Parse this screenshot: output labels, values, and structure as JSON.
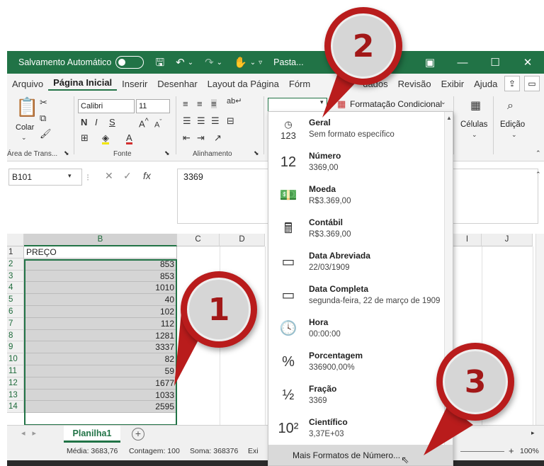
{
  "titlebar": {
    "autosave_label": "Salvamento Automático",
    "toggle_state": "Desativado",
    "filename": "Pasta..."
  },
  "menu": [
    "Arquivo",
    "Página Inicial",
    "Inserir",
    "Desenhar",
    "Layout da Página",
    "Fórm",
    "dados",
    "Revisão",
    "Exibir",
    "Ajuda"
  ],
  "ribbon": {
    "paste_label": "Colar",
    "clipboard_group": "Área de Trans...",
    "font_name": "Calibri",
    "font_size": "11",
    "font_group": "Fonte",
    "align_group": "Alinhamento",
    "number_format_value": "",
    "conditional_format": "Formatação Condicional",
    "cells_label": "Células",
    "edit_label": "Edição"
  },
  "formula_bar": {
    "cell_ref": "B101",
    "formula": "3369"
  },
  "grid": {
    "columns": [
      "B",
      "C",
      "D",
      "I",
      "J"
    ],
    "rows": [
      {
        "row": "1",
        "value": "PREÇO"
      },
      {
        "row": "2",
        "value": "853"
      },
      {
        "row": "3",
        "value": "853"
      },
      {
        "row": "4",
        "value": "1010"
      },
      {
        "row": "5",
        "value": "40"
      },
      {
        "row": "6",
        "value": "102"
      },
      {
        "row": "7",
        "value": "112"
      },
      {
        "row": "8",
        "value": "1281"
      },
      {
        "row": "9",
        "value": "3337"
      },
      {
        "row": "10",
        "value": "82"
      },
      {
        "row": "11",
        "value": "59"
      },
      {
        "row": "12",
        "value": "1677"
      },
      {
        "row": "13",
        "value": "1033"
      },
      {
        "row": "14",
        "value": "2595"
      }
    ]
  },
  "sheet_tab": "Planilha1",
  "status": {
    "media": "Média: 3683,76",
    "contagem": "Contagem: 100",
    "soma": "Soma: 368376",
    "exi": "Exi",
    "zoom": "100%"
  },
  "number_formats": [
    {
      "name": "Geral",
      "value": "Sem formato específico",
      "icon": "clock-123-icon"
    },
    {
      "name": "Número",
      "value": "3369,00",
      "icon": "number-12-icon"
    },
    {
      "name": "Moeda",
      "value": "R$3.369,00",
      "icon": "currency-icon"
    },
    {
      "name": "Contábil",
      "value": "R$3.369,00",
      "icon": "calculator-icon"
    },
    {
      "name": "Data Abreviada",
      "value": "22/03/1909",
      "icon": "calendar-short-icon"
    },
    {
      "name": "Data Completa",
      "value": "segunda-feira, 22 de março de 1909",
      "icon": "calendar-long-icon"
    },
    {
      "name": "Hora",
      "value": "00:00:00",
      "icon": "clock-icon"
    },
    {
      "name": "Porcentagem",
      "value": "336900,00%",
      "icon": "percent-icon"
    },
    {
      "name": "Fração",
      "value": "3369",
      "icon": "fraction-icon"
    },
    {
      "name": "Científico",
      "value": "3,37E+03",
      "icon": "scientific-icon"
    }
  ],
  "more_formats": "Mais Formatos de Número...",
  "callouts": [
    "1",
    "2",
    "3"
  ],
  "colors": {
    "excel_green": "#217346",
    "callout_red": "#b91c1c"
  }
}
